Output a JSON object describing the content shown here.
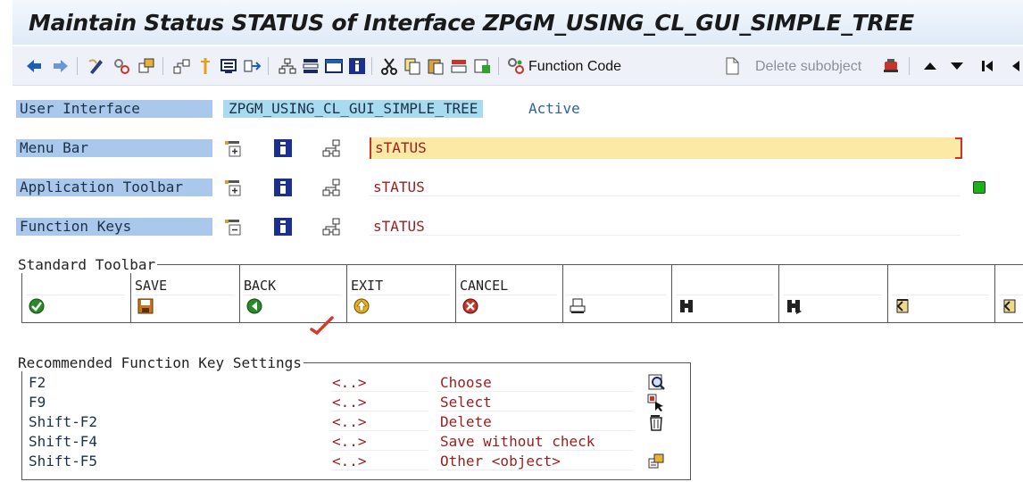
{
  "title": "Maintain Status STATUS of Interface ZPGM_USING_CL_GUI_SIMPLE_TREE",
  "toolbar": {
    "function_code_label": "Function Code",
    "delete_subobject_label": "Delete subobject"
  },
  "header": {
    "user_interface_label": "User Interface",
    "user_interface_value": "ZPGM_USING_CL_GUI_SIMPLE_TREE",
    "user_interface_state": "Active",
    "menu_bar_label": "Menu Bar",
    "menu_bar_value": "sTATUS",
    "app_toolbar_label": "Application Toolbar",
    "app_toolbar_value": "sTATUS",
    "function_keys_label": "Function Keys",
    "function_keys_value": "sTATUS"
  },
  "standard_toolbar": {
    "title": "Standard Toolbar",
    "cells": [
      {
        "label": "",
        "icon": "check-icon"
      },
      {
        "label": "SAVE",
        "icon": "save-icon"
      },
      {
        "label": "BACK",
        "icon": "back-icon"
      },
      {
        "label": "EXIT",
        "icon": "exit-icon"
      },
      {
        "label": "CANCEL",
        "icon": "cancel-icon"
      },
      {
        "label": "",
        "icon": "print-icon"
      },
      {
        "label": "",
        "icon": "find-icon"
      },
      {
        "label": "",
        "icon": "find-next-icon"
      },
      {
        "label": "",
        "icon": "first-page-icon"
      },
      {
        "label": "",
        "icon": "previous-page-icon"
      }
    ]
  },
  "recommended": {
    "title": "Recommended Function Key Settings",
    "rows": [
      {
        "key": "F2",
        "code": "<..>",
        "text": "Choose",
        "icon": "choose-icon"
      },
      {
        "key": "F9",
        "code": "<..>",
        "text": "Select",
        "icon": "select-icon"
      },
      {
        "key": "Shift-F2",
        "code": "<..>",
        "text": "Delete",
        "icon": "delete-icon"
      },
      {
        "key": "Shift-F4",
        "code": "<..>",
        "text": "Save without check",
        "icon": ""
      },
      {
        "key": "Shift-F5",
        "code": "<..>",
        "text": "Other <object>",
        "icon": "other-object-icon"
      }
    ]
  },
  "colors": {
    "label_bg": "#a9c8ec",
    "menu_highlight": "#fde9a6",
    "link_blue": "#2a63a8",
    "value_red": "#9a1d1d",
    "status_green": "#19b319"
  }
}
